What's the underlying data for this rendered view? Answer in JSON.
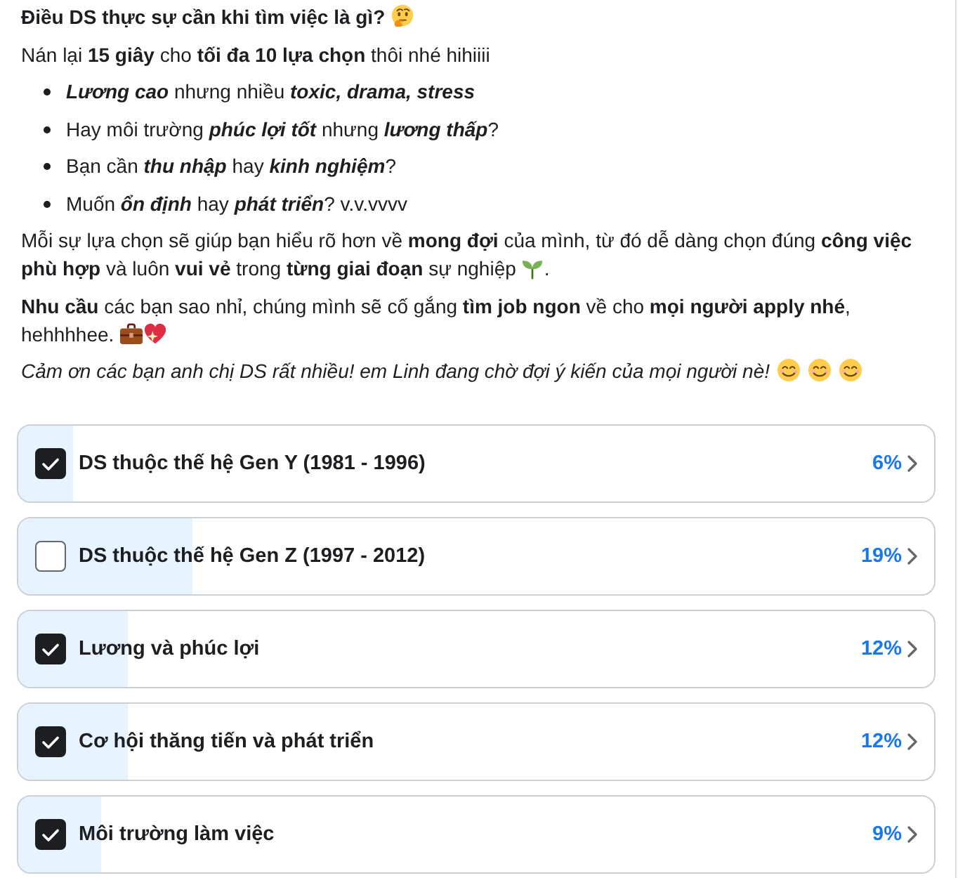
{
  "post": {
    "title": "Điều DS thực sự cần khi tìm việc là gì?",
    "intro": "Nán lại **15 giây** cho **tối đa 10 lựa chọn** thôi nhé hihiiii",
    "bullets": [
      [
        {
          "text": "Lương cao",
          "emphasis": true
        },
        {
          "text": " nhưng nhiều ",
          "emphasis": false
        },
        {
          "text": "toxic, drama, stress",
          "emphasis": true
        }
      ],
      [
        {
          "text": "Hay môi trường ",
          "emphasis": false
        },
        {
          "text": "phúc lợi tốt",
          "emphasis": true
        },
        {
          "text": " nhưng ",
          "emphasis": false
        },
        {
          "text": "lương thấp",
          "emphasis": true
        },
        {
          "text": "?",
          "emphasis": false
        }
      ],
      [
        {
          "text": "Bạn cần ",
          "emphasis": false
        },
        {
          "text": "thu nhập",
          "emphasis": true
        },
        {
          "text": " hay ",
          "emphasis": false
        },
        {
          "text": "kinh nghiệm",
          "emphasis": true
        },
        {
          "text": "?",
          "emphasis": false
        }
      ],
      [
        {
          "text": "Muốn ",
          "emphasis": false
        },
        {
          "text": "ổn định",
          "emphasis": true
        },
        {
          "text": " hay ",
          "emphasis": false
        },
        {
          "text": "phát triển",
          "emphasis": true
        },
        {
          "text": "? v.v.vvvv",
          "emphasis": false
        }
      ]
    ],
    "paragraphs": [
      {
        "kind": "body",
        "text": "Mỗi sự lựa chọn sẽ giúp bạn hiểu rõ hơn về **mong đợi** của mình, từ đó dễ dàng chọn đúng **công việc phù hợp** và luôn **vui vẻ** trong **từng giai đoạn** sự nghiệp",
        "end": "."
      },
      {
        "kind": "body",
        "text": "**Nhu cầu** các bạn sao nhỉ, chúng mình sẽ cố gắng **tìm job ngon** về cho **mọi người apply nhé**, hehhhhee."
      },
      {
        "kind": "note",
        "text": "Cảm ơn các bạn anh chị DS rất nhiều! em Linh đang chờ đợi ý kiến của mọi người nè!"
      }
    ]
  },
  "poll": {
    "options": [
      {
        "label": "DS thuộc thế hệ Gen Y (1981 - 1996)",
        "checked": true,
        "level": 0.06,
        "percent": "6%"
      },
      {
        "label": "DS thuộc thế hệ Gen Z (1997 - 2012)",
        "checked": false,
        "level": 0.19,
        "percent": "19%"
      },
      {
        "label": "Lương và phúc lợi",
        "checked": true,
        "level": 0.12,
        "percent": "12%"
      },
      {
        "label": "Cơ hội thăng tiến và phát triển",
        "checked": true,
        "level": 0.12,
        "percent": "12%"
      },
      {
        "label": "Môi trường làm việc",
        "checked": true,
        "level": 0.09,
        "percent": "9%"
      }
    ]
  }
}
